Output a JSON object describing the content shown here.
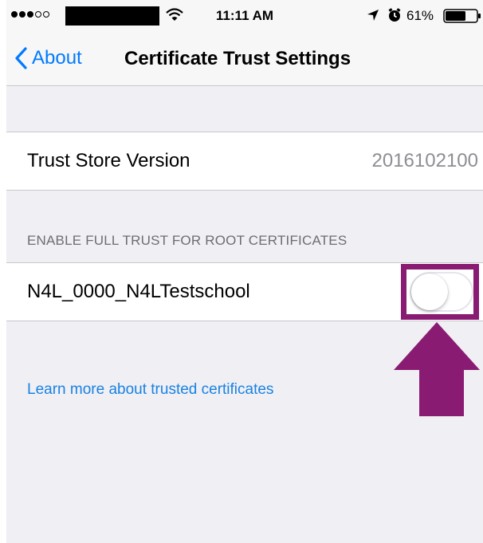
{
  "status_bar": {
    "signal_bars_filled": 3,
    "signal_bars_total": 5,
    "time": "11:11 AM",
    "battery_percent": "61%",
    "icons": [
      "signal-dots-icon",
      "wifi-icon",
      "location-arrow-icon",
      "alarm-icon",
      "battery-icon"
    ]
  },
  "nav": {
    "back_label": "About",
    "title": "Certificate Trust Settings"
  },
  "trust_store": {
    "label": "Trust Store Version",
    "value": "2016102100"
  },
  "section": {
    "header": "ENABLE FULL TRUST FOR ROOT CERTIFICATES"
  },
  "certificates": [
    {
      "name": "N4L_0000_N4LTestschool",
      "enabled": false
    }
  ],
  "link": {
    "text": "Learn more about trusted certificates"
  },
  "colors": {
    "accent": "#007aff",
    "link": "#1a82e2",
    "annotation": "#8a1b72",
    "background": "#efeff4"
  }
}
